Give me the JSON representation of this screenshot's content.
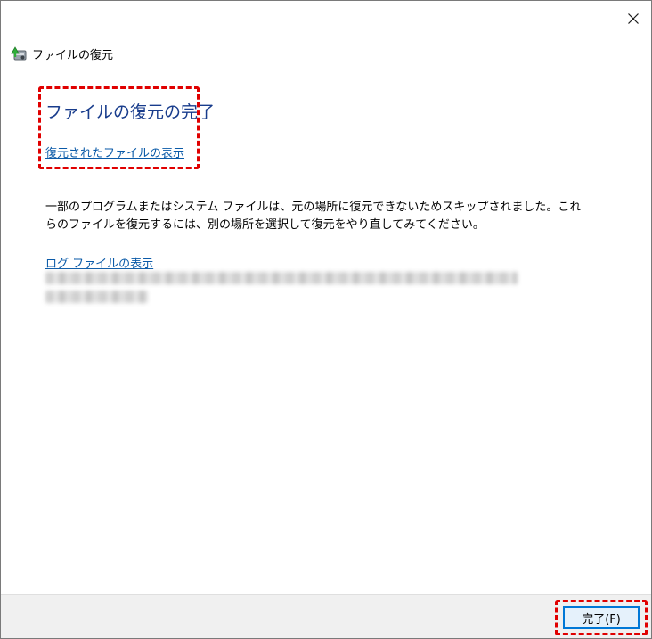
{
  "window": {
    "title": "ファイルの復元",
    "close_glyph": "✕"
  },
  "main": {
    "heading": "ファイルの復元の完了",
    "restored_link": "復元されたファイルの表示",
    "message": "一部のプログラムまたはシステム ファイルは、元の場所に復元できないためスキップされました。これらのファイルを復元するには、別の場所を選択して復元をやり直してみてください。",
    "log_link": "ログ ファイルの表示"
  },
  "footer": {
    "finish_label": "完了(F)"
  },
  "colors": {
    "heading": "#183c8c",
    "link": "#0a5aa8",
    "highlight": "#e00000",
    "button_border": "#0078d7",
    "button_fill": "#e5f1fb",
    "footer_bg": "#f0f0f0"
  },
  "icons": {
    "app": "file-restore-icon",
    "close": "close-icon"
  }
}
